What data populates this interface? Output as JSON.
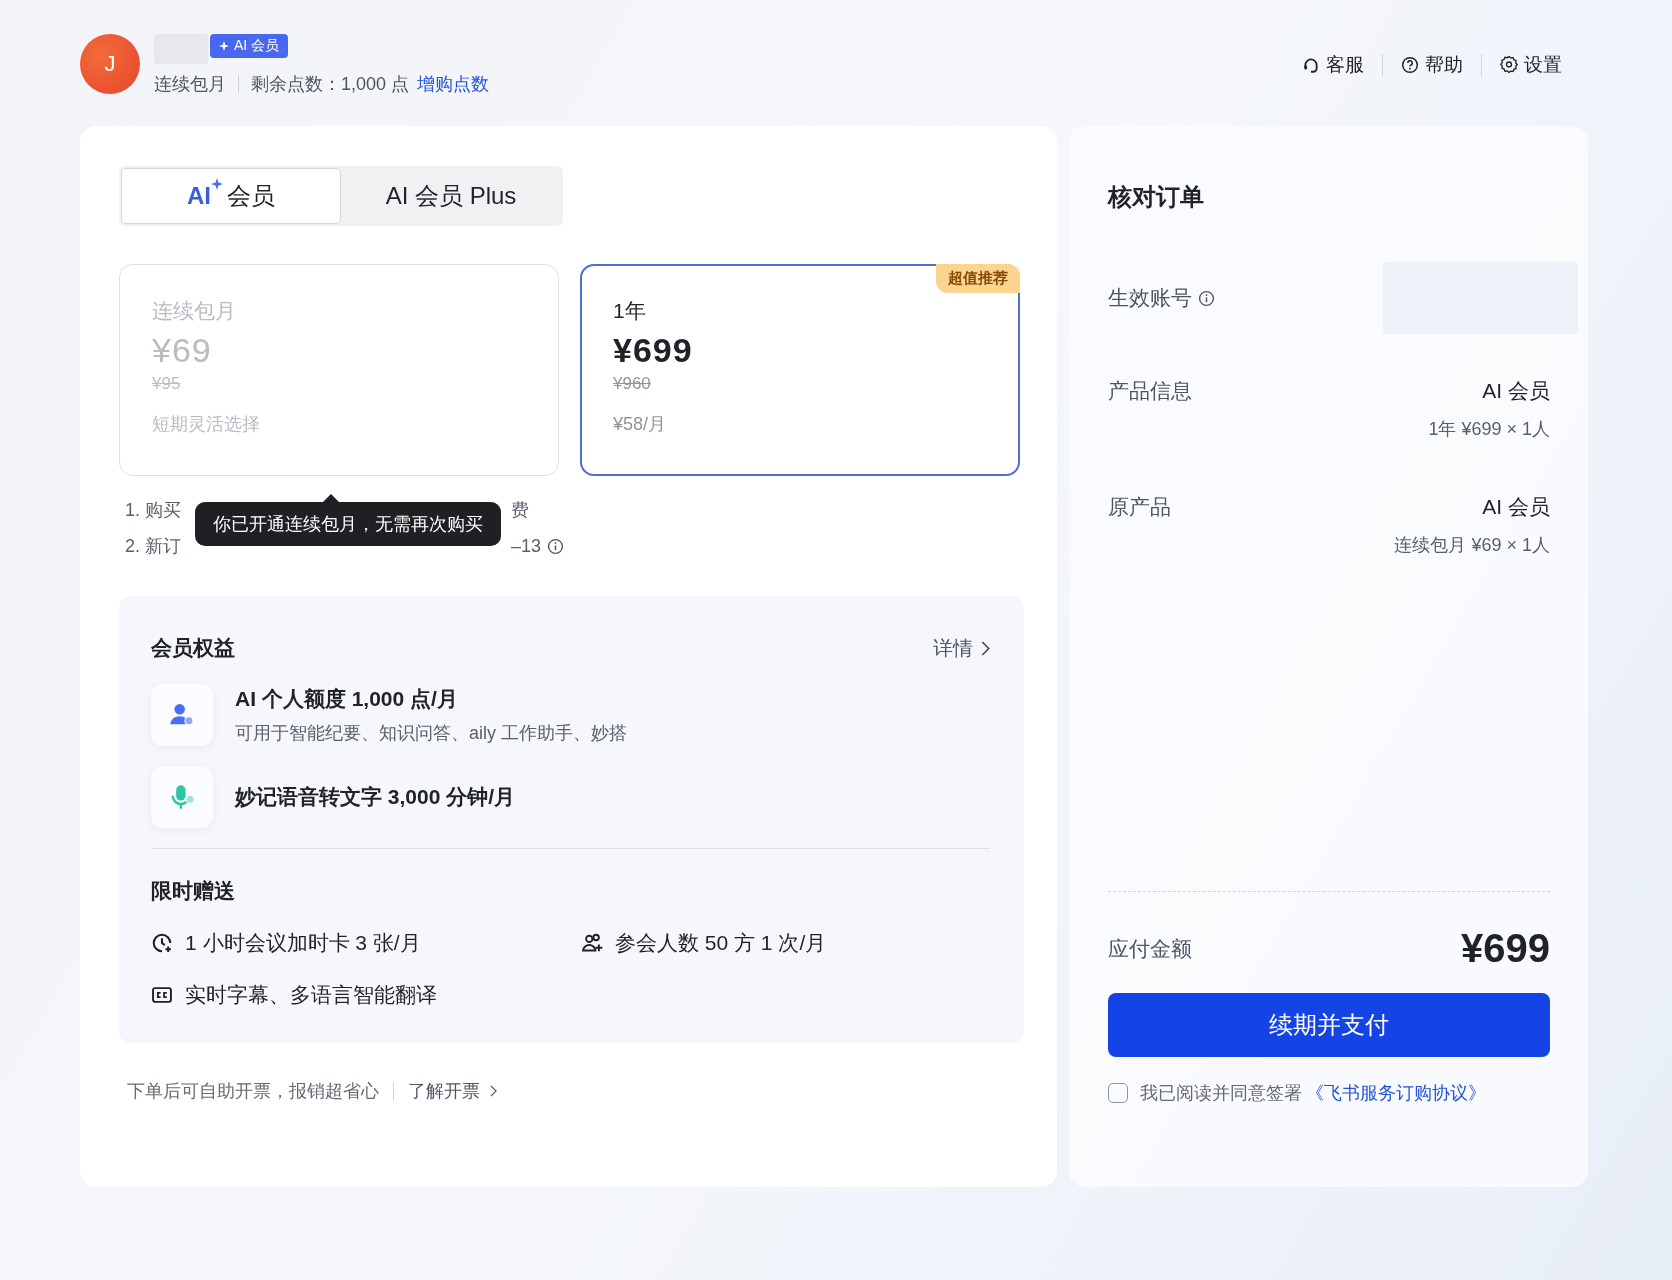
{
  "header": {
    "avatar_letter": "J",
    "badge": "AI 会员",
    "plan": "连续包月",
    "points": "剩余点数：1,000 点",
    "buy_points_link": "增购点数",
    "actions": [
      {
        "label": "客服",
        "kind": "headset"
      },
      {
        "label": "帮助",
        "kind": "help"
      },
      {
        "label": "设置",
        "kind": "settings"
      }
    ]
  },
  "tabs": [
    {
      "label": "会员",
      "kind": "ai-logo",
      "logo_text": "AI",
      "selected": true
    },
    {
      "label": "AI 会员 Plus",
      "kind": "plain",
      "selected": false
    }
  ],
  "plans": [
    {
      "name": "连续包月",
      "price": "¥69",
      "original_price": "¥95",
      "note": "短期灵活选择",
      "selected": false,
      "disabled": true
    },
    {
      "name": "1年",
      "price": "¥699",
      "original_price": "¥960",
      "note": "¥58/月",
      "selected": true,
      "disabled": false,
      "badge": "超值推荐"
    }
  ],
  "notes": [
    {
      "start": "1. 购买",
      "end": "费",
      "info": false
    },
    {
      "start": "2. 新订",
      "end": "–13",
      "info": true
    }
  ],
  "tooltip": "你已开通连续包月，无需再次购买",
  "benefits": {
    "title": "会员权益",
    "details_link": "详情",
    "items": [
      {
        "kind": "person",
        "title": "AI 个人额度 1,000 点/月",
        "subtitle": "可用于智能纪要、知识问答、aily 工作助手、妙搭"
      },
      {
        "kind": "mic",
        "title": "妙记语音转文字 3,000 分钟/月"
      }
    ],
    "gifts_title": "限时赠送",
    "gifts": [
      {
        "kind": "clock",
        "label": "1 小时会议加时卡 3 张/月"
      },
      {
        "kind": "people",
        "label": "参会人数 50 方 1 次/月"
      },
      {
        "kind": "cc",
        "label": "实时字幕、多语言智能翻译"
      }
    ]
  },
  "invoice": {
    "text": "下单后可自助开票，报销超省心",
    "link": "了解开票"
  },
  "order": {
    "title": "核对订单",
    "account_label": "生效账号",
    "rows": [
      {
        "label": "产品信息",
        "value": "AI 会员",
        "detail": "1年 ¥699 × 1人"
      },
      {
        "label": "原产品",
        "value": "AI 会员",
        "detail": "连续包月 ¥69 × 1人"
      }
    ],
    "total_label": "应付金额",
    "total": "¥699",
    "pay_button": "续期并支付",
    "agreement": {
      "checked": false,
      "text": "我已阅读并同意签署",
      "link": "《飞书服务订购协议》"
    }
  }
}
